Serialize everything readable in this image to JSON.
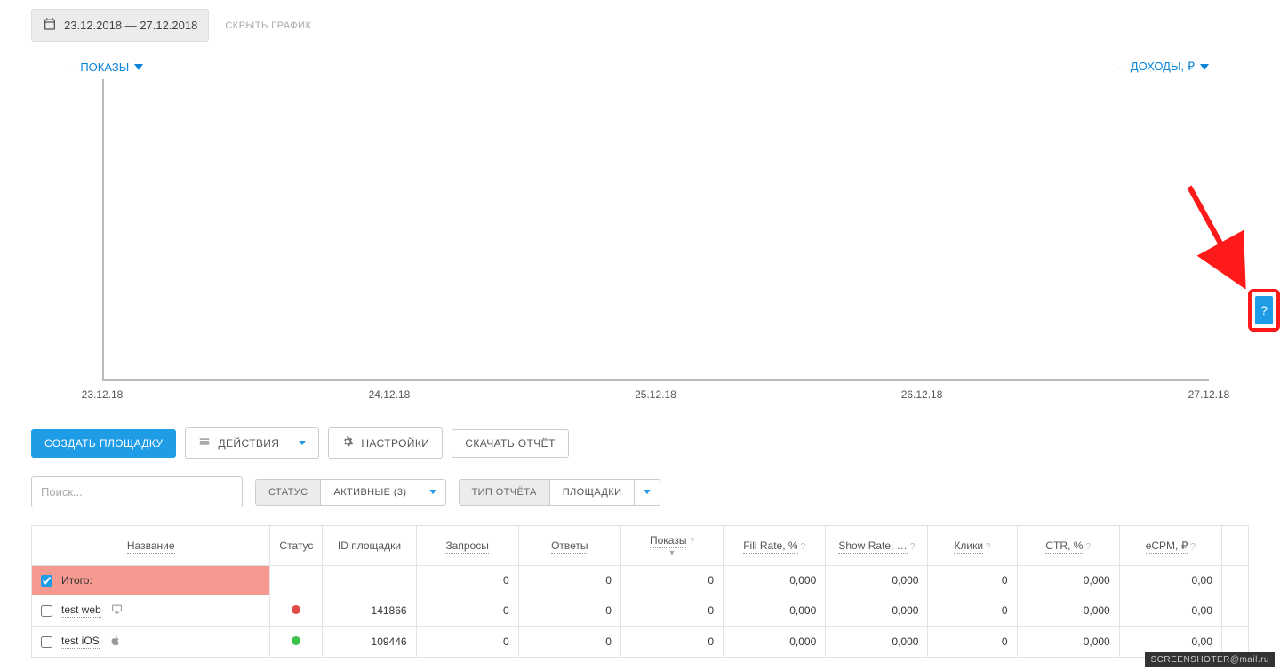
{
  "date_range": "23.12.2018 — 27.12.2018",
  "hide_chart": "СКРЫТЬ ГРАФИК",
  "left_metric": {
    "prefix": "--",
    "label": "ПОКАЗЫ"
  },
  "right_metric": {
    "prefix": "--",
    "label": "ДОХОДЫ, ₽"
  },
  "chart_data": {
    "type": "line",
    "x": [
      "23.12.18",
      "24.12.18",
      "25.12.18",
      "26.12.18",
      "27.12.18"
    ],
    "series": [
      {
        "name": "Показы",
        "values": [
          0,
          0,
          0,
          0,
          0
        ]
      },
      {
        "name": "Доходы, ₽",
        "values": [
          0,
          0,
          0,
          0,
          0
        ]
      }
    ],
    "ylim": [
      0,
      null
    ]
  },
  "buttons": {
    "create": "СОЗДАТЬ ПЛОЩАДКУ",
    "actions": "ДЕЙСТВИЯ",
    "settings": "НАСТРОЙКИ",
    "download": "СКАЧАТЬ ОТЧЁТ"
  },
  "search_placeholder": "Поиск...",
  "filters": {
    "status_label": "СТАТУС",
    "status_value": "АКТИВНЫЕ (3)",
    "type_label": "ТИП ОТЧЁТА",
    "type_value": "ПЛОЩАДКИ"
  },
  "columns": {
    "name": "Название",
    "status": "Статус",
    "id": "ID площадки",
    "requests": "Запросы",
    "responses": "Ответы",
    "shows": "Показы",
    "fill": "Fill Rate, %",
    "show_rate": "Show Rate, …",
    "clicks": "Клики",
    "ctr": "CTR, %",
    "ecpm": "eCPM, ₽"
  },
  "rows": [
    {
      "checked": true,
      "name": "Итого:",
      "device": "",
      "status_color": "",
      "id": "",
      "requests": "0",
      "responses": "0",
      "shows": "0",
      "fill": "0,000",
      "show_rate": "0,000",
      "clicks": "0",
      "ctr": "0,000",
      "ecpm": "0,00",
      "total": true
    },
    {
      "checked": false,
      "name": "test web",
      "device": "web",
      "status_color": "#e04a47",
      "id": "141866",
      "requests": "0",
      "responses": "0",
      "shows": "0",
      "fill": "0,000",
      "show_rate": "0,000",
      "clicks": "0",
      "ctr": "0,000",
      "ecpm": "0,00",
      "total": false
    },
    {
      "checked": false,
      "name": "test iOS",
      "device": "ios",
      "status_color": "#3bc24b",
      "id": "109446",
      "requests": "0",
      "responses": "0",
      "shows": "0",
      "fill": "0,000",
      "show_rate": "0,000",
      "clicks": "0",
      "ctr": "0,000",
      "ecpm": "0,00",
      "total": false
    }
  ],
  "help": "?",
  "watermark": "SCREENSHOTER@mail.ru"
}
